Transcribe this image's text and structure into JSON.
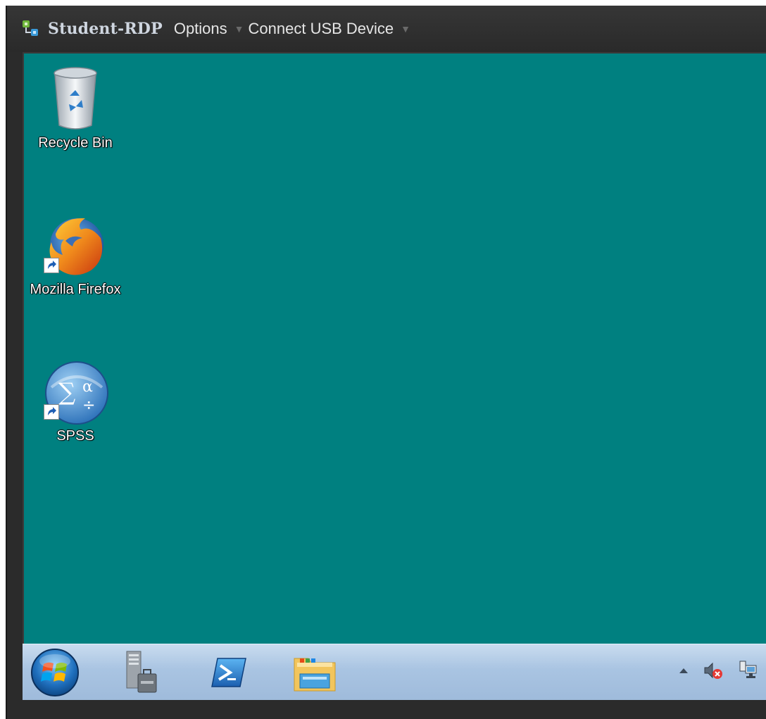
{
  "window": {
    "title": "Student-RDP",
    "menu": [
      {
        "label": "Options"
      },
      {
        "label": "Connect USB Device"
      }
    ]
  },
  "desktop": {
    "background": "#008080",
    "icons": [
      {
        "label": "Recycle Bin",
        "icon": "recycle-bin-icon"
      },
      {
        "label": "Mozilla Firefox",
        "icon": "firefox-icon",
        "shortcut": true
      },
      {
        "label": "SPSS",
        "icon": "spss-icon",
        "shortcut": true
      }
    ]
  },
  "taskbar": {
    "items": [
      {
        "icon": "start-orb-icon"
      },
      {
        "icon": "server-manager-icon"
      },
      {
        "icon": "powershell-icon"
      },
      {
        "icon": "file-explorer-icon"
      }
    ],
    "tray": [
      {
        "icon": "show-hidden-icons-arrow"
      },
      {
        "icon": "volume-muted-icon"
      },
      {
        "icon": "network-icon"
      }
    ]
  }
}
